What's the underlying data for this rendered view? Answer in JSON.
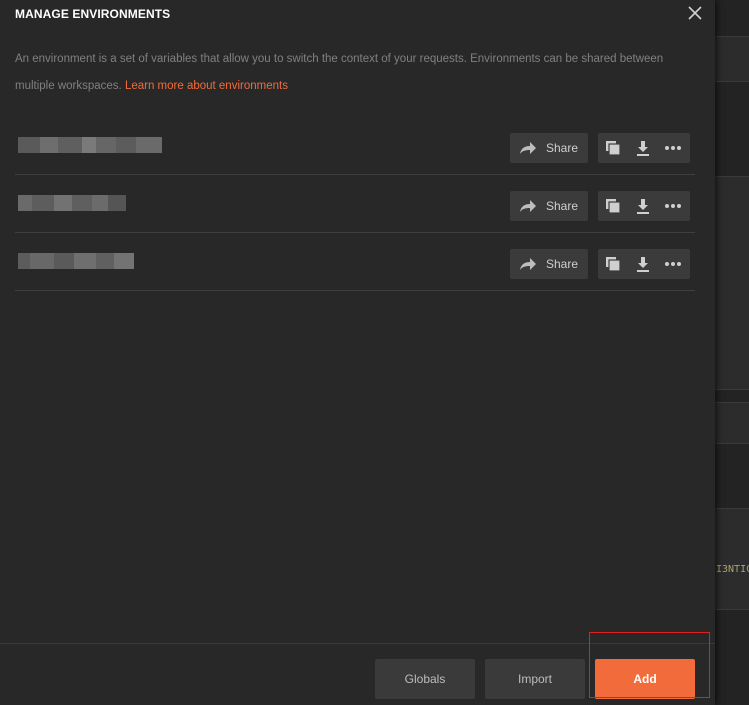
{
  "modal": {
    "title": "MANAGE ENVIRONMENTS",
    "description": "An environment is a set of variables that allow you to switch the context of your requests. Environments can be shared between multiple workspaces.",
    "learn_more": "Learn more about environments"
  },
  "environments": [
    {
      "share_label": "Share"
    },
    {
      "share_label": "Share"
    },
    {
      "share_label": "Share"
    }
  ],
  "footer": {
    "globals": "Globals",
    "import": "Import",
    "add": "Add"
  },
  "background": {
    "code_fragment": "I3NTIC"
  },
  "colors": {
    "accent": "#f26b3a",
    "modal_bg": "#282828",
    "button_bg": "#3b3b3b",
    "highlight": "#e0201f"
  },
  "icons": [
    "close-icon",
    "share-icon",
    "duplicate-icon",
    "download-icon",
    "more-icon"
  ]
}
